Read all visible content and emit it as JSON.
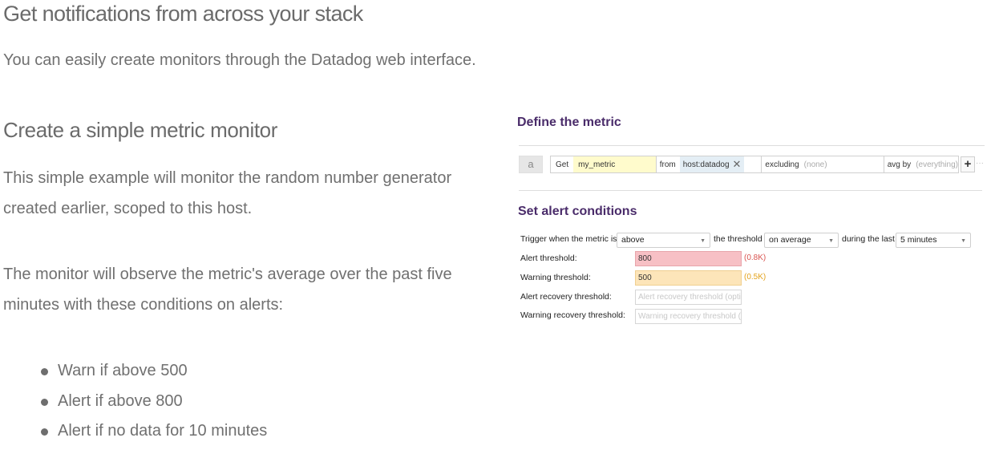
{
  "page": {
    "title": "Get notifications from across your stack",
    "intro": "You can easily create monitors through the Datadog web interface."
  },
  "section": {
    "title": "Create a simple metric monitor",
    "para1": "This simple example will monitor the random number generator created earlier, scoped to this host.",
    "para2": "The monitor will observe the metric's average over the past five minutes with these conditions on alerts:",
    "bullets": [
      "Warn if above 500",
      "Alert if above 800",
      "Alert if no data for 10 minutes"
    ]
  },
  "panel": {
    "define_title": "Define the metric",
    "query": {
      "letter": "a",
      "get_label": "Get",
      "metric": "my_metric",
      "from_label": "from",
      "from_tag": "host:datadog",
      "excluding_label": "excluding",
      "excluding_value": "(none)",
      "avg_label": "avg by",
      "avg_value": "(everything)",
      "add_icon": "plus-icon"
    },
    "alert_title": "Set alert conditions",
    "trigger_prefix": "Trigger when the metric is",
    "trigger_select": "above",
    "threshold_text": "the threshold",
    "aggregation_select": "on average",
    "during_text": "during the last",
    "window_select": "5 minutes",
    "alert_threshold_label": "Alert threshold:",
    "alert_threshold_value": "800",
    "alert_threshold_hint": "(0.8K)",
    "warning_threshold_label": "Warning threshold:",
    "warning_threshold_value": "500",
    "warning_threshold_hint": "(0.5K)",
    "alert_recovery_label": "Alert recovery threshold:",
    "alert_recovery_placeholder": "Alert recovery threshold (optio",
    "warning_recovery_label": "Warning recovery threshold:",
    "warning_recovery_placeholder": "Warning recovery threshold (o"
  },
  "colors": {
    "heading_purple": "#4a2c6a",
    "alert_fill": "#f7c0c5",
    "warning_fill": "#fde5b9",
    "alert_hint": "#d9534f",
    "warning_hint": "#e3a21a"
  }
}
